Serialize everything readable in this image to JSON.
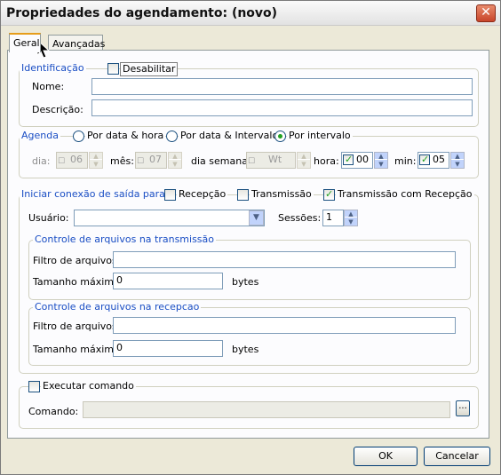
{
  "window": {
    "title": "Propriedades do agendamento: (novo)",
    "close": "✕"
  },
  "tabs": [
    {
      "label": "Geral"
    },
    {
      "label": "Avançadas"
    }
  ],
  "identificacao": {
    "legend": "Identificação",
    "disable_label": "Desabilitar",
    "disable_checked": false,
    "nome_label": "Nome:",
    "nome_value": "",
    "descricao_label": "Descrição:",
    "descricao_value": ""
  },
  "agenda": {
    "legend": "Agenda",
    "options": [
      "Por data & hora",
      "Por data & Intervalo",
      "Por intervalo"
    ],
    "selected": "Por intervalo",
    "dia_label": "dia:",
    "dia_value": "06",
    "mes_label": "mês:",
    "mes_value": "07",
    "dia_semana_label": "dia semana:",
    "dia_semana_value": "Wt",
    "hora_label": "hora:",
    "hora_value": "00",
    "min_label": "min:",
    "min_value": "05"
  },
  "conexao": {
    "legend": "Iniciar conexão de saída para:",
    "recepcao_label": "Recepção",
    "transmissao_label": "Transmissão",
    "trans_rec_label": "Transmissão com Recepção",
    "trans_rec_checked": true,
    "usuario_label": "Usuário:",
    "usuario_value": "",
    "sessoes_label": "Sessões:",
    "sessoes_value": "1",
    "transmissao_group": {
      "legend": "Controle de arquivos na transmissão",
      "filtro_label": "Filtro de arquivos:",
      "filtro_value": "",
      "tamanho_label": "Tamanho máximo:",
      "tamanho_value": "0",
      "unit": "bytes"
    },
    "recepcao_group": {
      "legend": "Controle de arquivos na recepcao",
      "filtro_label": "Filtro de arquivos:",
      "filtro_value": "",
      "tamanho_label": "Tamanho máximo:",
      "tamanho_value": "0",
      "unit": "bytes"
    }
  },
  "executar": {
    "label": "Executar comando",
    "comando_label": "Comando:",
    "comando_value": "",
    "browse_label": "..."
  },
  "buttons": {
    "ok": "OK",
    "cancel": "Cancelar"
  }
}
